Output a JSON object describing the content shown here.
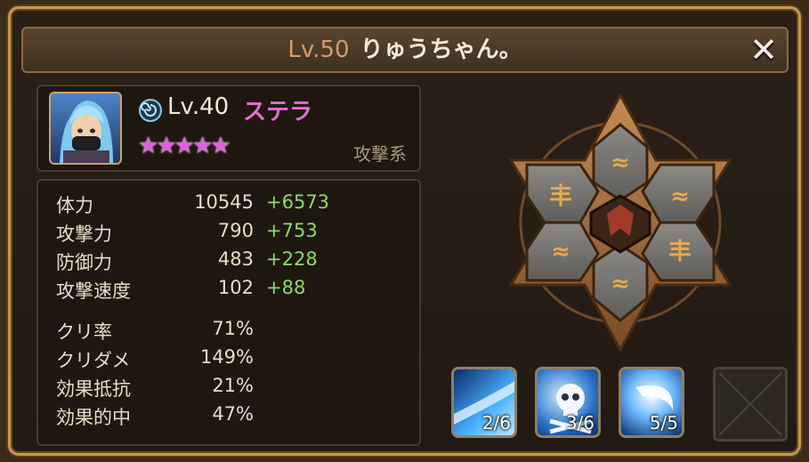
{
  "header": {
    "level": "Lv.50",
    "name": "りゅうちゃん。",
    "close_icon": "close-icon"
  },
  "monster": {
    "level": "Lv.40",
    "name": "ステラ",
    "element_icon": "wind-element-icon",
    "stars": 5,
    "type": "攻撃系"
  },
  "stats": [
    {
      "label": "体力",
      "value": "10545",
      "bonus": "+6573"
    },
    {
      "label": "攻撃力",
      "value": "790",
      "bonus": "+753"
    },
    {
      "label": "防御力",
      "value": "483",
      "bonus": "+228"
    },
    {
      "label": "攻撃速度",
      "value": "102",
      "bonus": "+88"
    },
    {
      "label": "クリ率",
      "value": "71%",
      "bonus": ""
    },
    {
      "label": "クリダメ",
      "value": "149%",
      "bonus": ""
    },
    {
      "label": "効果抵抗",
      "value": "21%",
      "bonus": ""
    },
    {
      "label": "効果的中",
      "value": "47%",
      "bonus": ""
    }
  ],
  "skills": [
    {
      "icon": "slash-skill-icon",
      "level": "2/6"
    },
    {
      "icon": "skull-skill-icon",
      "level": "3/6"
    },
    {
      "icon": "crescent-skill-icon",
      "level": "5/5"
    }
  ],
  "colors": {
    "frame_gold": "#c69a4e",
    "star_pink": "#e060e0",
    "bonus_green": "#8edd55",
    "name_pink": "#e26bd4"
  }
}
